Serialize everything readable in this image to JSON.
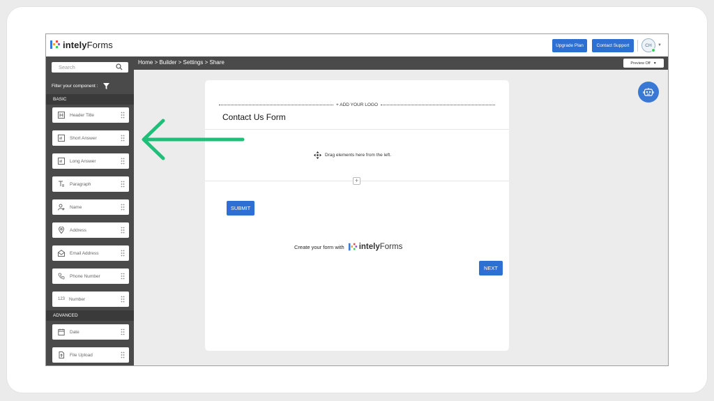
{
  "brand": {
    "name_bold": "intely",
    "name_light": "Forms"
  },
  "header": {
    "upgrade_label": "Upgrade Plan",
    "support_label": "Contact Support",
    "avatar_initials": "CH"
  },
  "sidebar": {
    "search_placeholder": "Search",
    "filter_label": "Filter your component :",
    "sections": {
      "basic": "BASIC",
      "advanced": "ADVANCED"
    },
    "basic_items": [
      {
        "label": "Header Title",
        "icon": "header-icon"
      },
      {
        "label": "Short Answer",
        "icon": "short-answer-icon"
      },
      {
        "label": "Long Answer",
        "icon": "long-answer-icon"
      },
      {
        "label": "Paragraph",
        "icon": "paragraph-icon"
      },
      {
        "label": "Name",
        "icon": "person-icon"
      },
      {
        "label": "Address",
        "icon": "location-pin-icon"
      },
      {
        "label": "Email Address",
        "icon": "envelope-icon"
      },
      {
        "label": "Phone Number",
        "icon": "phone-icon"
      },
      {
        "label": "Number",
        "icon": "number-icon",
        "glyph": "123"
      }
    ],
    "advanced_items": [
      {
        "label": "Date",
        "icon": "calendar-icon"
      },
      {
        "label": "File Upload",
        "icon": "file-upload-icon"
      }
    ]
  },
  "breadcrumb": {
    "text": "Home > Builder > Settings > Share"
  },
  "preview": {
    "label": "Preview Off"
  },
  "form": {
    "logo_placeholder": "+ ADD YOUR LOGO",
    "title": "Contact Us Form",
    "drop_hint": "Drag elements here from the left.",
    "submit_label": "SUBMIT",
    "created_with": "Create your form with",
    "next_label": "NEXT"
  },
  "colors": {
    "accent": "#2e6fd3",
    "sidebar": "#4a4a4a",
    "annotation_arrow": "#1fbf7a"
  }
}
